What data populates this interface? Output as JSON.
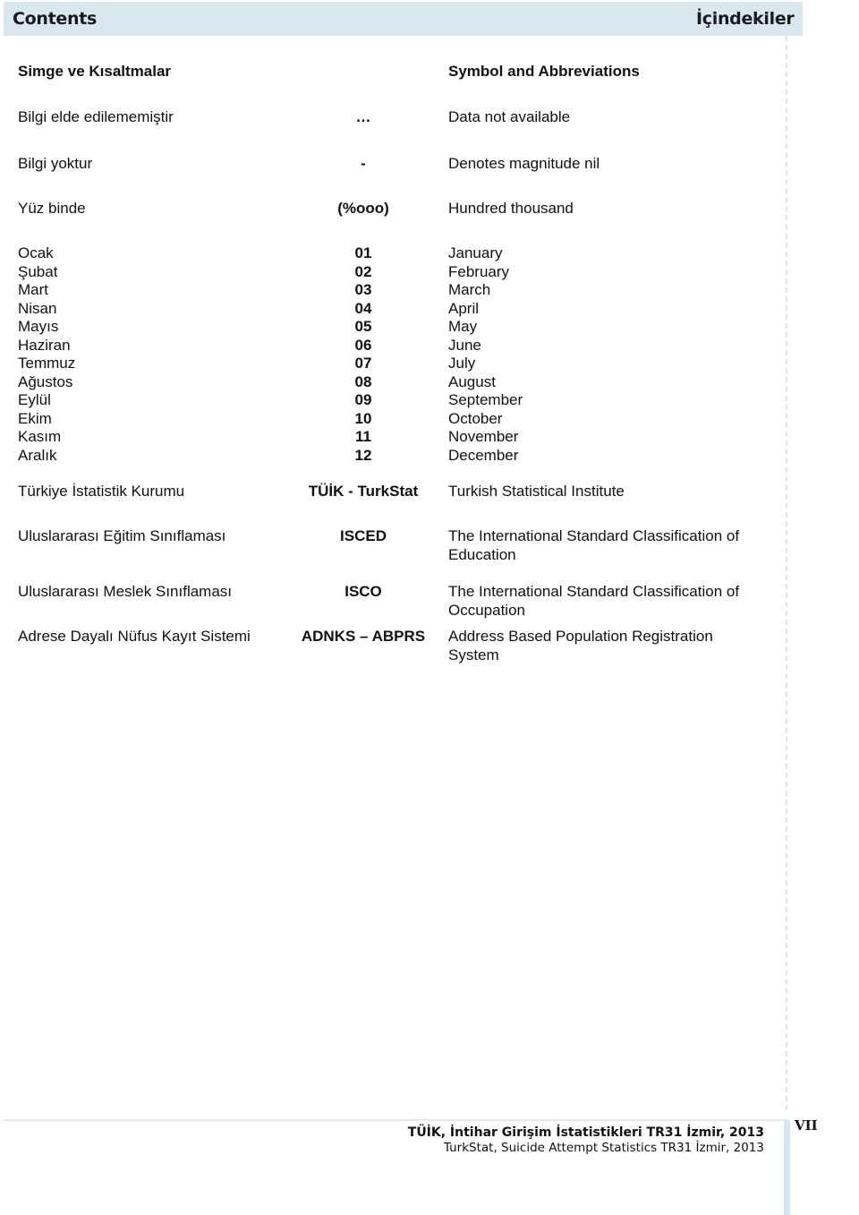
{
  "header": {
    "left_title": "Contents",
    "right_title": "İçindekiler"
  },
  "section": {
    "tr_heading": "Simge ve Kısaltmalar",
    "en_heading": "Symbol and Abbreviations"
  },
  "symbols": [
    {
      "tr": "Bilgi elde edilememiştir",
      "symbol": "…",
      "en": "Data  not available"
    },
    {
      "tr": "Bilgi yoktur",
      "symbol": "-",
      "en": "Denotes magnitude nil"
    },
    {
      "tr": "Yüz binde",
      "symbol": "(%ooo)",
      "en": "Hundred thousand"
    }
  ],
  "months": [
    {
      "tr": "Ocak",
      "code": "01",
      "en": "January"
    },
    {
      "tr": "Şubat",
      "code": "02",
      "en": "February"
    },
    {
      "tr": "Mart",
      "code": "03",
      "en": "March"
    },
    {
      "tr": "Nisan",
      "code": "04",
      "en": "April"
    },
    {
      "tr": "Mayıs",
      "code": "05",
      "en": "May"
    },
    {
      "tr": "Haziran",
      "code": "06",
      "en": "June"
    },
    {
      "tr": "Temmuz",
      "code": "07",
      "en": "July"
    },
    {
      "tr": "Ağustos",
      "code": "08",
      "en": "August"
    },
    {
      "tr": "Eylül",
      "code": "09",
      "en": "September"
    },
    {
      "tr": "Ekim",
      "code": "10",
      "en": "October"
    },
    {
      "tr": "Kasım",
      "code": "11",
      "en": "November"
    },
    {
      "tr": "Aralık",
      "code": "12",
      "en": "December"
    }
  ],
  "abbreviations": [
    {
      "tr": "Türkiye İstatistik Kurumu",
      "abbr": "TÜİK - TurkStat",
      "en_line1": "Turkish Statistical Institute",
      "en_line2": ""
    },
    {
      "tr": "Uluslararası Eğitim Sınıflaması",
      "abbr": "ISCED",
      "en_line1": "The International Standard Classification of",
      "en_line2": "Education"
    },
    {
      "tr": "Uluslararası Meslek Sınıflaması",
      "abbr": "ISCO",
      "en_line1": "The International Standard Classification of",
      "en_line2": "Occupation"
    },
    {
      "tr": "Adrese Dayalı Nüfus Kayıt Sistemi",
      "abbr": "ADNKS – ABPRS",
      "en_line1": "Address Based Population Registration",
      "en_line2": "System"
    }
  ],
  "footer": {
    "title_tr": "TÜİK, İntihar Girişim İstatistikleri TR31 İzmir, 2013",
    "title_en": "TurkStat, Suicide Attempt Statistics TR31 İzmir, 2013",
    "page_number": "VII"
  }
}
